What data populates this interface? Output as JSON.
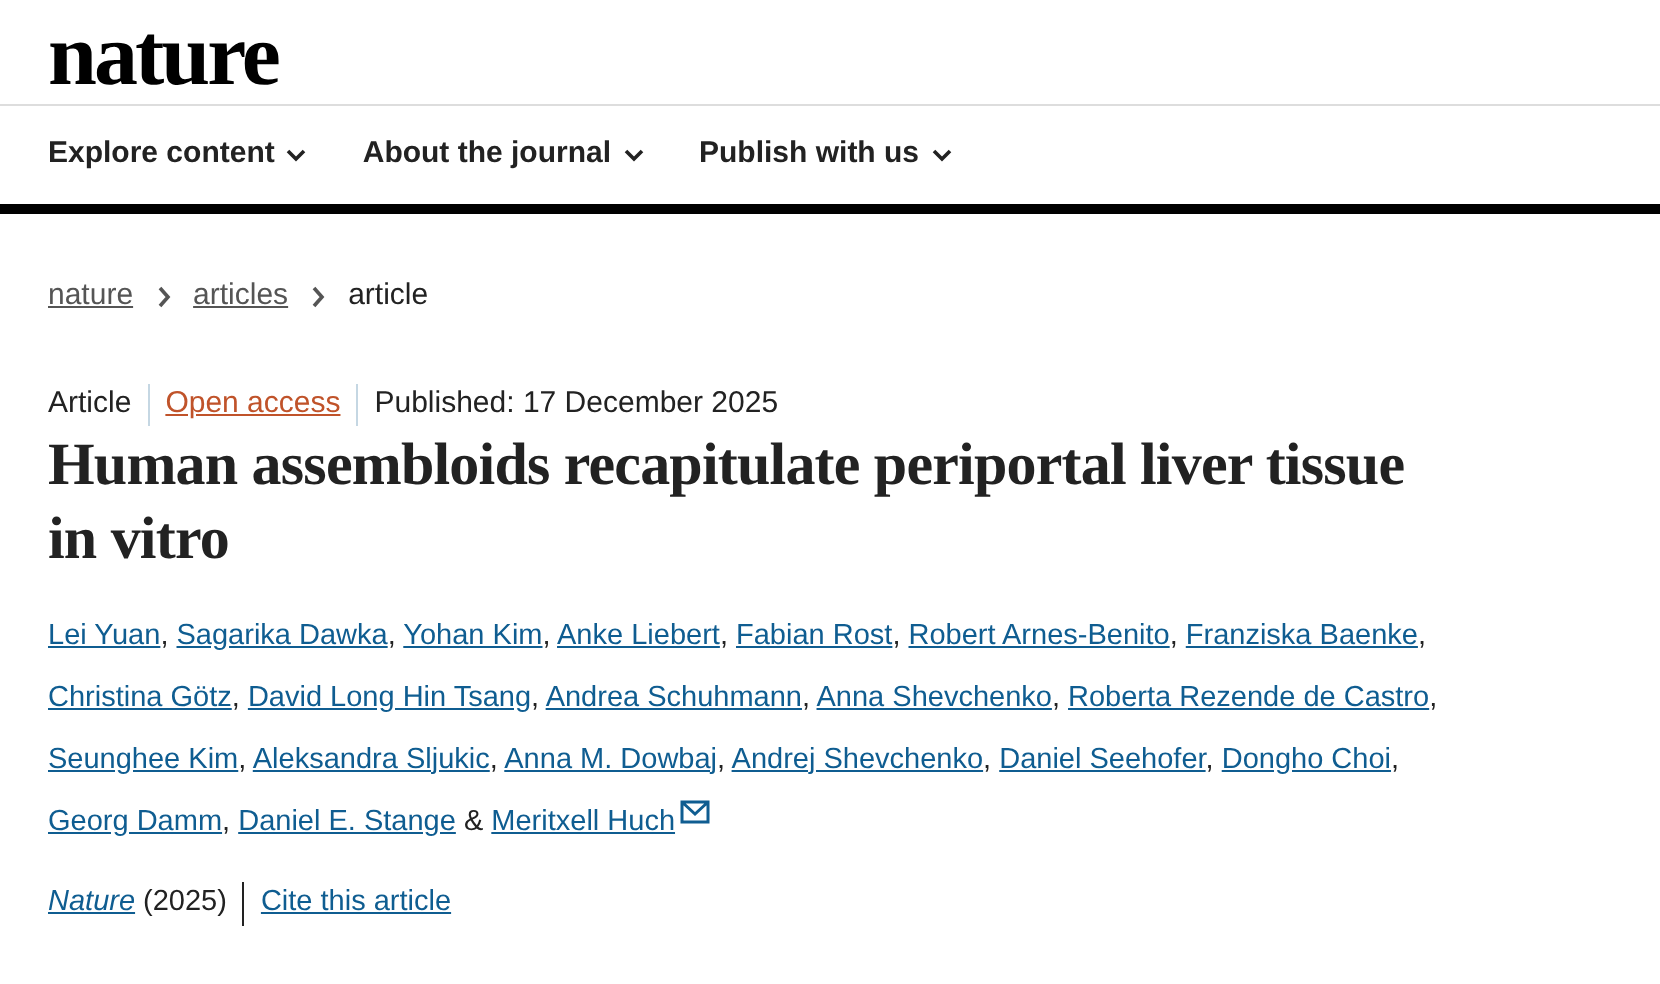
{
  "site": {
    "logo": "nature"
  },
  "nav": [
    {
      "label": "Explore content",
      "expanded": false
    },
    {
      "label": "About the journal",
      "expanded": false
    },
    {
      "label": "Publish with us",
      "expanded": false
    }
  ],
  "breadcrumb": [
    {
      "label": "nature",
      "link": true
    },
    {
      "label": "articles",
      "link": true
    },
    {
      "label": "article",
      "link": false
    }
  ],
  "article": {
    "type": "Article",
    "access": "Open access",
    "published": "Published: 17 December 2025",
    "title": "Human assembloids recapitulate periportal liver tissue in vitro",
    "authors": [
      {
        "name": "Lei Yuan",
        "after": ",",
        "email": false
      },
      {
        "name": "Sagarika Dawka",
        "after": ",",
        "email": false
      },
      {
        "name": "Yohan Kim",
        "after": ",",
        "email": false
      },
      {
        "name": "Anke Liebert",
        "after": ",",
        "email": false
      },
      {
        "name": "Fabian Rost",
        "after": ",",
        "email": false
      },
      {
        "name": "Robert Arnes-Benito",
        "after": ",",
        "email": false
      },
      {
        "name": "Franziska Baenke",
        "after": ",",
        "email": false
      },
      {
        "name": "Christina Götz",
        "after": ",",
        "email": false
      },
      {
        "name": "David Long Hin Tsang",
        "after": ",",
        "email": false
      },
      {
        "name": "Andrea Schuhmann",
        "after": ",",
        "email": false
      },
      {
        "name": "Anna Shevchenko",
        "after": ",",
        "email": false
      },
      {
        "name": "Roberta Rezende de Castro",
        "after": ",",
        "email": false
      },
      {
        "name": "Seunghee Kim",
        "after": ",",
        "email": false
      },
      {
        "name": "Aleksandra Sljukic",
        "after": ",",
        "email": false
      },
      {
        "name": "Anna M. Dowbaj",
        "after": ",",
        "email": false
      },
      {
        "name": "Andrej Shevchenko",
        "after": ",",
        "email": false
      },
      {
        "name": "Daniel Seehofer",
        "after": ",",
        "email": false
      },
      {
        "name": "Dongho Choi",
        "after": ",",
        "email": false
      },
      {
        "name": "Georg Damm",
        "after": ",",
        "email": false
      },
      {
        "name": "Daniel E. Stange",
        "after": "&",
        "email": false
      },
      {
        "name": "Meritxell Huch",
        "email": true
      }
    ],
    "journal": "Nature",
    "year": "(2025)",
    "cite": "Cite this article"
  }
}
